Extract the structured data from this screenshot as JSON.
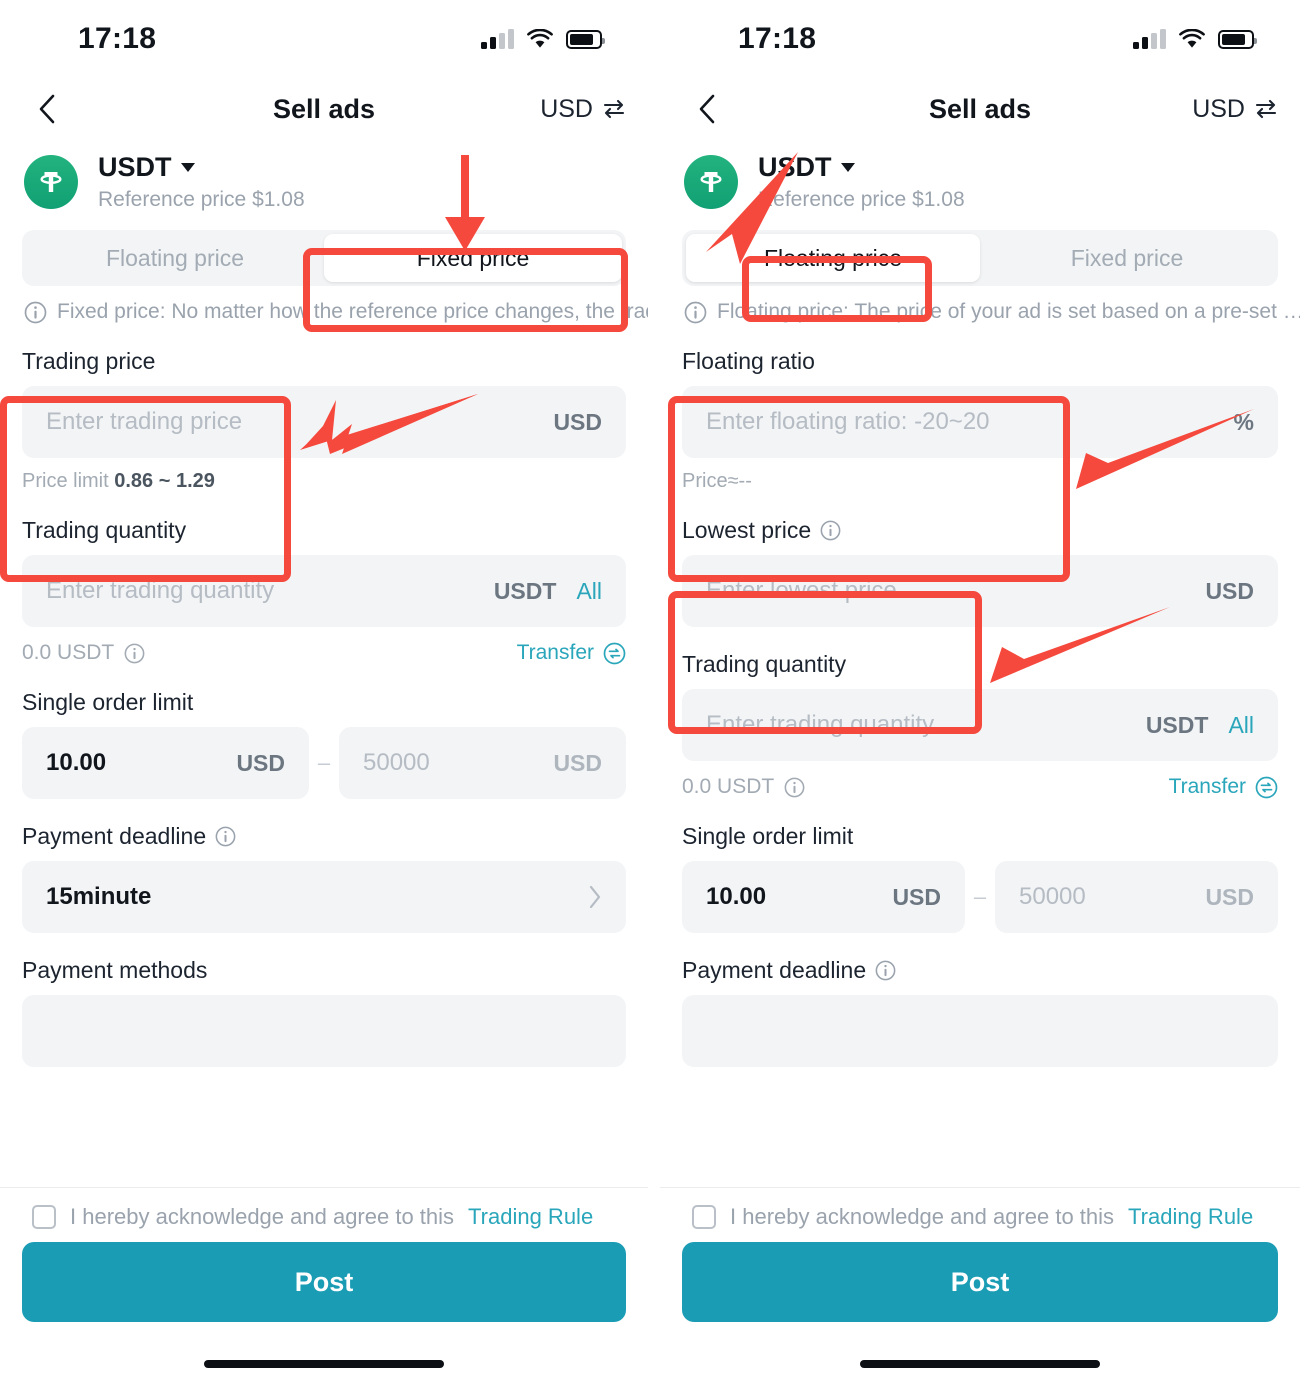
{
  "status": {
    "time": "17:18",
    "signal_icon": "signal-bars-icon",
    "wifi_icon": "wifi-icon",
    "battery_icon": "battery-icon"
  },
  "nav": {
    "back_icon": "chevron-left-icon",
    "title": "Sell ads",
    "currency": "USD",
    "swap_icon": "swap-arrows-icon"
  },
  "coin": {
    "symbol": "USDT",
    "logo_icon": "tether-logo-icon",
    "dropdown_icon": "caret-down-icon",
    "reference_price": "Reference price $1.08",
    "brand_color": "#16a47a"
  },
  "tabs": {
    "floating": "Floating price",
    "fixed": "Fixed price"
  },
  "hints": {
    "fixed": "Fixed price: No matter how the reference price changes, the tradi…",
    "floating": "Floating price: The price of your ad is set based on a pre-set …",
    "info_icon": "info-circle-icon"
  },
  "left_panel": {
    "active_tab": "Fixed price",
    "trading_price": {
      "label": "Trading price",
      "placeholder": "Enter trading price",
      "suffix": "USD",
      "note_prefix": "Price limit ",
      "note_value": "0.86 ~ 1.29"
    },
    "trading_quantity": {
      "label": "Trading quantity",
      "placeholder": "Enter trading quantity",
      "suffix": "USDT",
      "all_label": "All",
      "balance": "0.0 USDT",
      "balance_info_icon": "info-circle-icon",
      "transfer_label": "Transfer",
      "transfer_icon": "transfer-swap-circle-icon"
    },
    "single_order_limit": {
      "label": "Single order limit",
      "min_value": "10.00",
      "min_suffix": "USD",
      "separator": "–",
      "max_placeholder": "50000",
      "max_suffix": "USD"
    },
    "payment_deadline": {
      "label": "Payment deadline",
      "info_icon": "info-circle-icon",
      "value": "15minute",
      "chevron_icon": "chevron-right-icon"
    },
    "payment_methods": {
      "label": "Payment methods"
    }
  },
  "right_panel": {
    "active_tab": "Floating price",
    "floating_ratio": {
      "label": "Floating ratio",
      "placeholder": "Enter floating ratio: -20~20",
      "suffix": "%",
      "note": "Price≈--"
    },
    "lowest_price": {
      "label": "Lowest price",
      "info_icon": "info-circle-icon",
      "placeholder": "Enter lowest price",
      "suffix": "USD"
    },
    "trading_quantity": {
      "label": "Trading quantity",
      "placeholder": "Enter trading quantity",
      "suffix": "USDT",
      "all_label": "All",
      "balance": "0.0 USDT",
      "balance_info_icon": "info-circle-icon",
      "transfer_label": "Transfer",
      "transfer_icon": "transfer-swap-circle-icon"
    },
    "single_order_limit": {
      "label": "Single order limit",
      "min_value": "10.00",
      "min_suffix": "USD",
      "separator": "–",
      "max_placeholder": "50000",
      "max_suffix": "USD"
    },
    "payment_deadline": {
      "label": "Payment deadline",
      "info_icon": "info-circle-icon"
    }
  },
  "footer": {
    "agree_text": "I hereby acknowledge and agree to this",
    "agree_link": "Trading Rule",
    "post_label": "Post",
    "checkbox_icon": "checkbox-unchecked-icon"
  },
  "annotations": {
    "color": "#f5493d",
    "highlights": [
      "fixed-price-tab",
      "trading-price-field",
      "floating-price-tab",
      "floating-ratio-field",
      "lowest-price-field"
    ],
    "arrow_icon": "arrow-pointer-icon"
  }
}
